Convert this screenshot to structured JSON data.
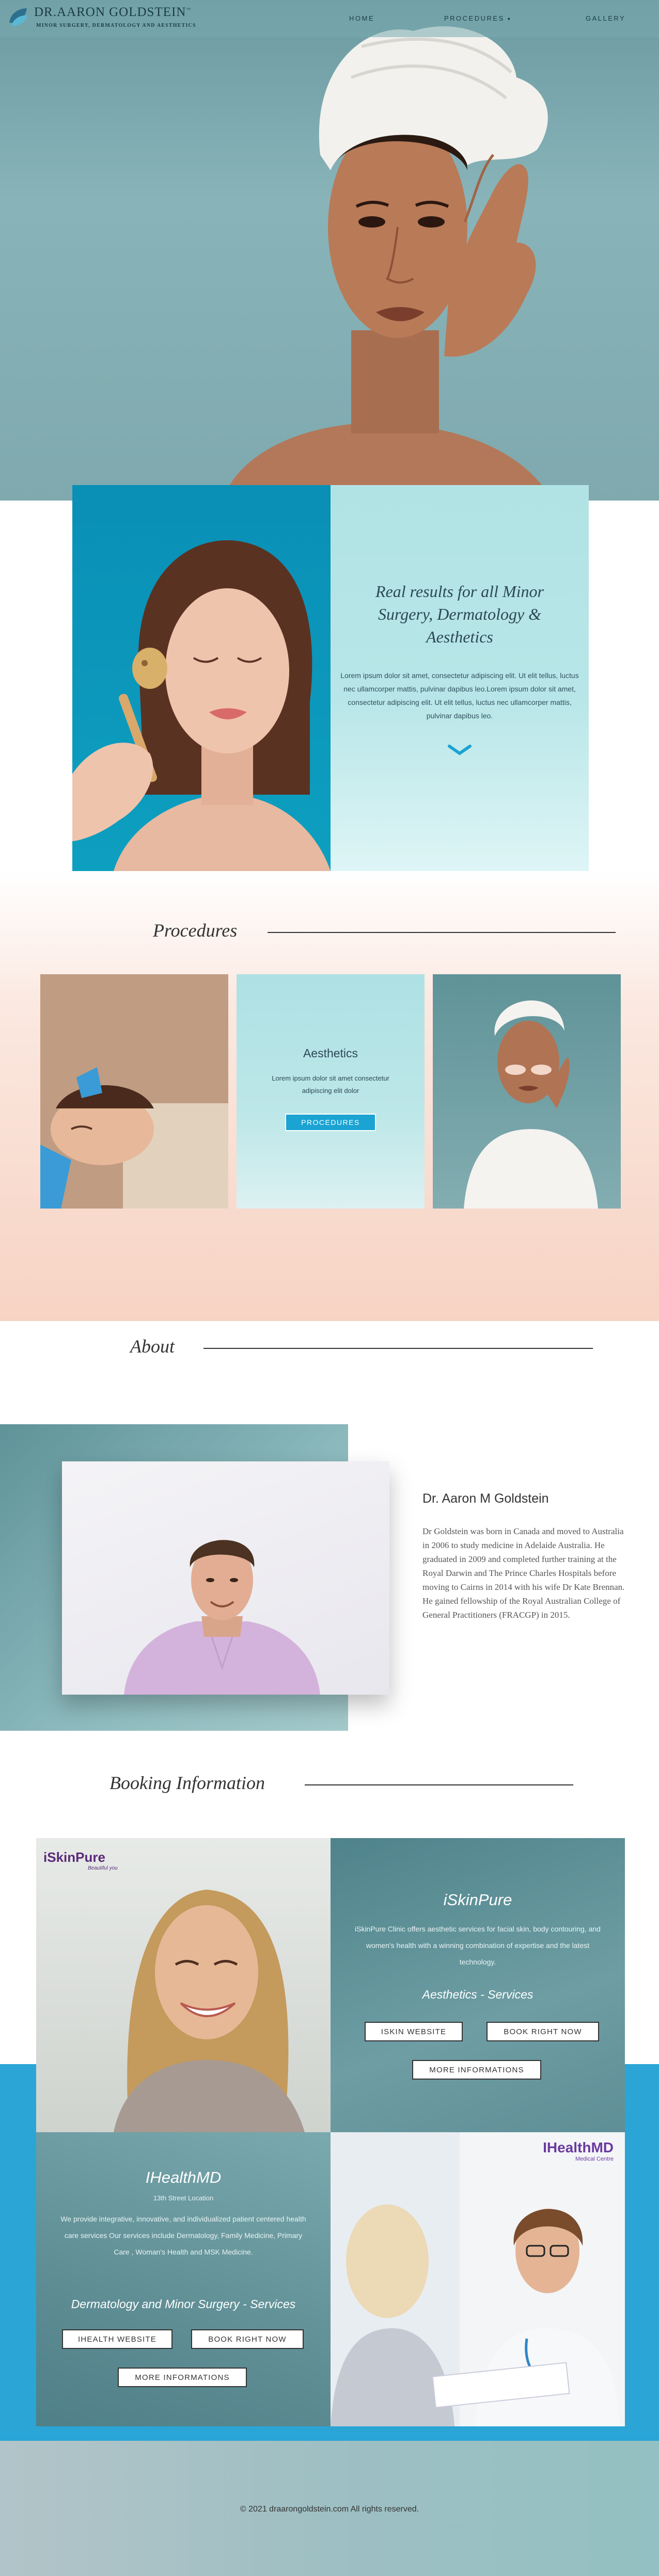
{
  "header": {
    "logo_name": "DR.AARON GOLDSTEIN",
    "logo_tm": "™",
    "logo_tagline": "MINOR SURGERY, DERMATOLOGY AND AESTHETICS",
    "nav": {
      "home": "HOME",
      "procedures": "PROCEDURES",
      "gallery": "GALLERY"
    }
  },
  "intro": {
    "title": "Real results for all Minor Surgery, Dermatology & Aesthetics",
    "text": "Lorem ipsum dolor sit amet, consectetur adipiscing elit. Ut elit tellus, luctus nec ullamcorper mattis, pulvinar dapibus leo.Lorem ipsum dolor sit amet, consectetur adipiscing elit. Ut elit tellus, luctus nec ullamcorper mattis, pulvinar dapibus leo."
  },
  "procedures": {
    "heading": "Procedures",
    "card_title": "Aesthetics",
    "card_text": "Lorem ipsum dolor sit amet consectetur adipiscing elit dolor",
    "card_button": "PROCEDURES"
  },
  "about": {
    "heading": "About",
    "name": "Dr. Aaron M Goldstein",
    "bio": "Dr Goldstein was born in Canada and moved to Australia in 2006 to study medicine in Adelaide Australia. He graduated in 2009 and completed further training at the Royal Darwin and The Prince Charles Hospitals before moving to Cairns in 2014 with his wife Dr Kate Brennan. He gained fellowship of the Royal Australian College of General Practitioners (FRACGP) in 2015."
  },
  "booking": {
    "heading": "Booking Information",
    "iskin": {
      "logo": "iSkinPure",
      "logo_tagline": "Beautiful you",
      "title": "iSkinPure",
      "text": "iSkinPure Clinic offers aesthetic services for facial skin, body contouring, and women's health with a winning combination of expertise and the latest technology.",
      "services": "Aesthetics - Services",
      "btn_website": "ISKIN WEBSITE",
      "btn_book": "BOOK RIGHT NOW",
      "btn_more": "MORE INFORMATIONS"
    },
    "ihealth": {
      "logo": "IHealthMD",
      "logo_tagline": "Medical Centre",
      "title": "IHealthMD",
      "address": "13th Street Location",
      "text": "We provide integrative, innovative, and individualized patient centered health care services Our services include Dermatology, Family Medicine, Primary Care , Woman's Health and MSK Medicine.",
      "services": "Dermatology and Minor Surgery - Services",
      "btn_website": "IHEALTH WEBSITE",
      "btn_book": "BOOK RIGHT NOW",
      "btn_more": "MORE INFORMATIONS"
    }
  },
  "footer": {
    "copyright": "© 2021 draarongoldstein.com All rights reserved."
  },
  "colors": {
    "accent_blue": "#1ba3d2",
    "teal": "#5e9399",
    "peach": "#f7d3c3",
    "dark_text": "#2c4855"
  }
}
